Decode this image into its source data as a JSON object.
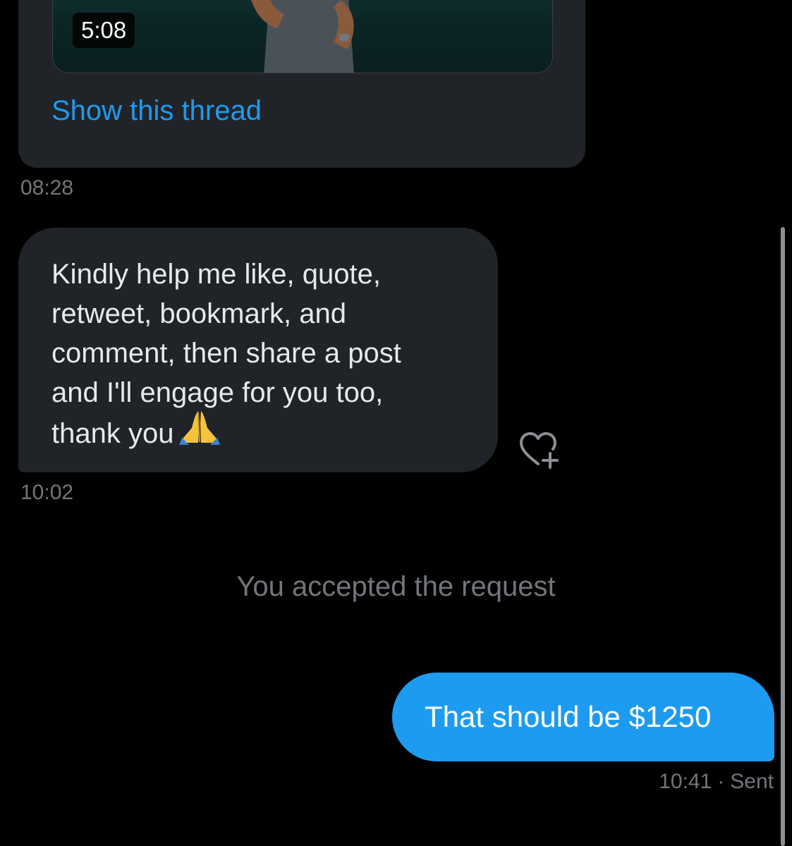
{
  "thread_card": {
    "video_duration": "5:08",
    "show_thread_label": "Show this thread",
    "timestamp": "08:28"
  },
  "received_message": {
    "lines": [
      "Kindly help me like, quote,",
      "retweet, bookmark, and",
      "comment, then share a post",
      "and I'll engage for you too,",
      "thank you"
    ],
    "emoji": "🙏",
    "timestamp": "10:02",
    "react_icon": "heart-plus-icon"
  },
  "system_notice": "You accepted the request",
  "sent_message": {
    "text": "That should be $1250",
    "timestamp": "10:41",
    "separator": "·",
    "status": "Sent"
  },
  "colors": {
    "background": "#000000",
    "received_bubble": "#202327",
    "sent_bubble": "#1d9bf0",
    "link": "#1d9bf0",
    "muted_text": "#71767b",
    "primary_text": "#e7e9ea"
  }
}
